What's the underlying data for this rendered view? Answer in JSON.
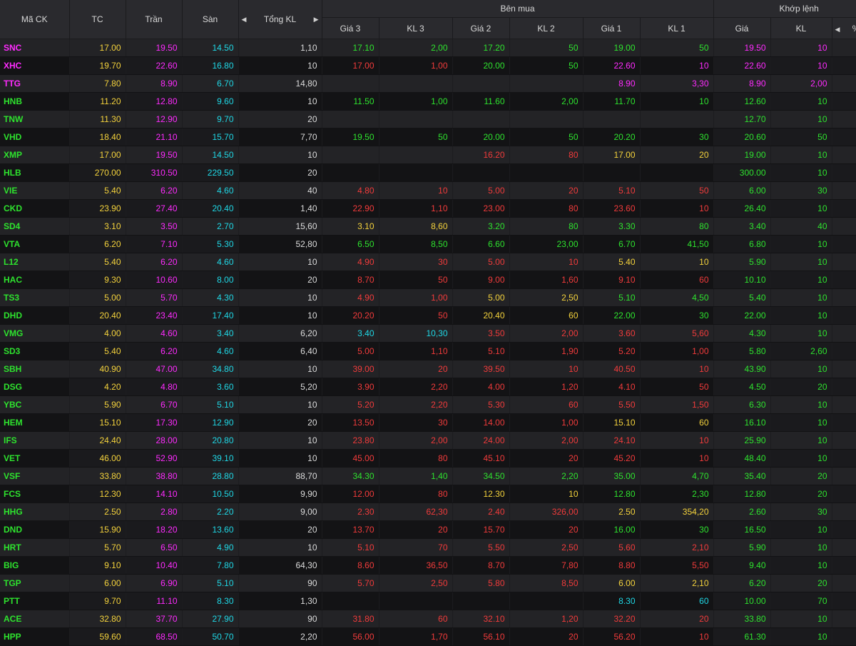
{
  "header": {
    "ma_ck": "Mã CK",
    "tc": "TC",
    "tran": "Trần",
    "san": "Sàn",
    "tong_kl": "Tổng KL",
    "ben_mua": "Bên mua",
    "khop_lenh": "Khớp lệnh",
    "gia3": "Giá 3",
    "kl3": "KL 3",
    "gia2": "Giá 2",
    "kl2": "KL 2",
    "gia1": "Giá 1",
    "kl1": "KL 1",
    "khop_gia": "Giá",
    "khop_kl": "KL",
    "pct": "%"
  },
  "colors": {
    "purple": "#ff2bff",
    "yellow": "#f5d33c",
    "cyan": "#1fd8e6",
    "green": "#2ee32e",
    "red": "#f23b3b"
  },
  "rows": [
    {
      "sym": "SNC",
      "symc": "purple",
      "tc": "17.00",
      "tran": "19.50",
      "san": "14.50",
      "vol": "1,10",
      "g3": "17.10",
      "g3c": "green",
      "k3": "2,00",
      "g2": "17.20",
      "g2c": "green",
      "k2": "50",
      "g1": "19.00",
      "g1c": "green",
      "k1": "50",
      "kg": "19.50",
      "kgc": "purple",
      "kk": "10"
    },
    {
      "sym": "XHC",
      "symc": "purple",
      "tc": "19.70",
      "tran": "22.60",
      "san": "16.80",
      "vol": "10",
      "g3": "17.00",
      "g3c": "red",
      "k3": "1,00",
      "g2": "20.00",
      "g2c": "green",
      "k2": "50",
      "g1": "22.60",
      "g1c": "purple",
      "k1": "10",
      "kg": "22.60",
      "kgc": "purple",
      "kk": "10"
    },
    {
      "sym": "TTG",
      "symc": "purple",
      "tc": "7.80",
      "tran": "8.90",
      "san": "6.70",
      "vol": "14,80",
      "g3": "",
      "g3c": "green",
      "k3": "",
      "g2": "",
      "g2c": "green",
      "k2": "",
      "g1": "8.90",
      "g1c": "purple",
      "k1": "3,30",
      "kg": "8.90",
      "kgc": "purple",
      "kk": "2,00"
    },
    {
      "sym": "HNB",
      "symc": "green",
      "tc": "11.20",
      "tran": "12.80",
      "san": "9.60",
      "vol": "10",
      "g3": "11.50",
      "g3c": "green",
      "k3": "1,00",
      "g2": "11.60",
      "g2c": "green",
      "k2": "2,00",
      "g1": "11.70",
      "g1c": "green",
      "k1": "10",
      "kg": "12.60",
      "kgc": "green",
      "kk": "10"
    },
    {
      "sym": "TNW",
      "symc": "green",
      "tc": "11.30",
      "tran": "12.90",
      "san": "9.70",
      "vol": "20",
      "g3": "",
      "g3c": "green",
      "k3": "",
      "g2": "",
      "g2c": "green",
      "k2": "",
      "g1": "",
      "g1c": "green",
      "k1": "",
      "kg": "12.70",
      "kgc": "green",
      "kk": "10"
    },
    {
      "sym": "VHD",
      "symc": "green",
      "tc": "18.40",
      "tran": "21.10",
      "san": "15.70",
      "vol": "7,70",
      "g3": "19.50",
      "g3c": "green",
      "k3": "50",
      "g2": "20.00",
      "g2c": "green",
      "k2": "50",
      "g1": "20.20",
      "g1c": "green",
      "k1": "30",
      "kg": "20.60",
      "kgc": "green",
      "kk": "50"
    },
    {
      "sym": "XMP",
      "symc": "green",
      "tc": "17.00",
      "tran": "19.50",
      "san": "14.50",
      "vol": "10",
      "g3": "",
      "g3c": "green",
      "k3": "",
      "g2": "16.20",
      "g2c": "red",
      "k2": "80",
      "g1": "17.00",
      "g1c": "yellow",
      "k1": "20",
      "kg": "19.00",
      "kgc": "green",
      "kk": "10"
    },
    {
      "sym": "HLB",
      "symc": "green",
      "tc": "270.00",
      "tran": "310.50",
      "san": "229.50",
      "vol": "20",
      "g3": "",
      "g3c": "green",
      "k3": "",
      "g2": "",
      "g2c": "green",
      "k2": "",
      "g1": "",
      "g1c": "green",
      "k1": "",
      "kg": "300.00",
      "kgc": "green",
      "kk": "10"
    },
    {
      "sym": "VIE",
      "symc": "green",
      "tc": "5.40",
      "tran": "6.20",
      "san": "4.60",
      "vol": "40",
      "g3": "4.80",
      "g3c": "red",
      "k3": "10",
      "g2": "5.00",
      "g2c": "red",
      "k2": "20",
      "g1": "5.10",
      "g1c": "red",
      "k1": "50",
      "kg": "6.00",
      "kgc": "green",
      "kk": "30"
    },
    {
      "sym": "CKD",
      "symc": "green",
      "tc": "23.90",
      "tran": "27.40",
      "san": "20.40",
      "vol": "1,40",
      "g3": "22.90",
      "g3c": "red",
      "k3": "1,10",
      "g2": "23.00",
      "g2c": "red",
      "k2": "80",
      "g1": "23.60",
      "g1c": "red",
      "k1": "10",
      "kg": "26.40",
      "kgc": "green",
      "kk": "10"
    },
    {
      "sym": "SD4",
      "symc": "green",
      "tc": "3.10",
      "tran": "3.50",
      "san": "2.70",
      "vol": "15,60",
      "g3": "3.10",
      "g3c": "yellow",
      "k3": "8,60",
      "g2": "3.20",
      "g2c": "green",
      "k2": "80",
      "g1": "3.30",
      "g1c": "green",
      "k1": "80",
      "kg": "3.40",
      "kgc": "green",
      "kk": "40"
    },
    {
      "sym": "VTA",
      "symc": "green",
      "tc": "6.20",
      "tran": "7.10",
      "san": "5.30",
      "vol": "52,80",
      "g3": "6.50",
      "g3c": "green",
      "k3": "8,50",
      "g2": "6.60",
      "g2c": "green",
      "k2": "23,00",
      "g1": "6.70",
      "g1c": "green",
      "k1": "41,50",
      "kg": "6.80",
      "kgc": "green",
      "kk": "10"
    },
    {
      "sym": "L12",
      "symc": "green",
      "tc": "5.40",
      "tran": "6.20",
      "san": "4.60",
      "vol": "10",
      "g3": "4.90",
      "g3c": "red",
      "k3": "30",
      "g2": "5.00",
      "g2c": "red",
      "k2": "10",
      "g1": "5.40",
      "g1c": "yellow",
      "k1": "10",
      "kg": "5.90",
      "kgc": "green",
      "kk": "10"
    },
    {
      "sym": "HAC",
      "symc": "green",
      "tc": "9.30",
      "tran": "10.60",
      "san": "8.00",
      "vol": "20",
      "g3": "8.70",
      "g3c": "red",
      "k3": "50",
      "g2": "9.00",
      "g2c": "red",
      "k2": "1,60",
      "g1": "9.10",
      "g1c": "red",
      "k1": "60",
      "kg": "10.10",
      "kgc": "green",
      "kk": "10"
    },
    {
      "sym": "TS3",
      "symc": "green",
      "tc": "5.00",
      "tran": "5.70",
      "san": "4.30",
      "vol": "10",
      "g3": "4.90",
      "g3c": "red",
      "k3": "1,00",
      "g2": "5.00",
      "g2c": "yellow",
      "k2": "2,50",
      "g1": "5.10",
      "g1c": "green",
      "k1": "4,50",
      "kg": "5.40",
      "kgc": "green",
      "kk": "10"
    },
    {
      "sym": "DHD",
      "symc": "green",
      "tc": "20.40",
      "tran": "23.40",
      "san": "17.40",
      "vol": "10",
      "g3": "20.20",
      "g3c": "red",
      "k3": "50",
      "g2": "20.40",
      "g2c": "yellow",
      "k2": "60",
      "g1": "22.00",
      "g1c": "green",
      "k1": "30",
      "kg": "22.00",
      "kgc": "green",
      "kk": "10"
    },
    {
      "sym": "VMG",
      "symc": "green",
      "tc": "4.00",
      "tran": "4.60",
      "san": "3.40",
      "vol": "6,20",
      "g3": "3.40",
      "g3c": "cyan",
      "k3": "10,30",
      "g2": "3.50",
      "g2c": "red",
      "k2": "2,00",
      "g1": "3.60",
      "g1c": "red",
      "k1": "5,60",
      "kg": "4.30",
      "kgc": "green",
      "kk": "10"
    },
    {
      "sym": "SD3",
      "symc": "green",
      "tc": "5.40",
      "tran": "6.20",
      "san": "4.60",
      "vol": "6,40",
      "g3": "5.00",
      "g3c": "red",
      "k3": "1,10",
      "g2": "5.10",
      "g2c": "red",
      "k2": "1,90",
      "g1": "5.20",
      "g1c": "red",
      "k1": "1,00",
      "kg": "5.80",
      "kgc": "green",
      "kk": "2,60"
    },
    {
      "sym": "SBH",
      "symc": "green",
      "tc": "40.90",
      "tran": "47.00",
      "san": "34.80",
      "vol": "10",
      "g3": "39.00",
      "g3c": "red",
      "k3": "20",
      "g2": "39.50",
      "g2c": "red",
      "k2": "10",
      "g1": "40.50",
      "g1c": "red",
      "k1": "10",
      "kg": "43.90",
      "kgc": "green",
      "kk": "10"
    },
    {
      "sym": "DSG",
      "symc": "green",
      "tc": "4.20",
      "tran": "4.80",
      "san": "3.60",
      "vol": "5,20",
      "g3": "3.90",
      "g3c": "red",
      "k3": "2,20",
      "g2": "4.00",
      "g2c": "red",
      "k2": "1,20",
      "g1": "4.10",
      "g1c": "red",
      "k1": "50",
      "kg": "4.50",
      "kgc": "green",
      "kk": "20"
    },
    {
      "sym": "YBC",
      "symc": "green",
      "tc": "5.90",
      "tran": "6.70",
      "san": "5.10",
      "vol": "10",
      "g3": "5.20",
      "g3c": "red",
      "k3": "2,20",
      "g2": "5.30",
      "g2c": "red",
      "k2": "60",
      "g1": "5.50",
      "g1c": "red",
      "k1": "1,50",
      "kg": "6.30",
      "kgc": "green",
      "kk": "10"
    },
    {
      "sym": "HEM",
      "symc": "green",
      "tc": "15.10",
      "tran": "17.30",
      "san": "12.90",
      "vol": "20",
      "g3": "13.50",
      "g3c": "red",
      "k3": "30",
      "g2": "14.00",
      "g2c": "red",
      "k2": "1,00",
      "g1": "15.10",
      "g1c": "yellow",
      "k1": "60",
      "kg": "16.10",
      "kgc": "green",
      "kk": "10"
    },
    {
      "sym": "IFS",
      "symc": "green",
      "tc": "24.40",
      "tran": "28.00",
      "san": "20.80",
      "vol": "10",
      "g3": "23.80",
      "g3c": "red",
      "k3": "2,00",
      "g2": "24.00",
      "g2c": "red",
      "k2": "2,00",
      "g1": "24.10",
      "g1c": "red",
      "k1": "10",
      "kg": "25.90",
      "kgc": "green",
      "kk": "10"
    },
    {
      "sym": "VET",
      "symc": "green",
      "tc": "46.00",
      "tran": "52.90",
      "san": "39.10",
      "vol": "10",
      "g3": "45.00",
      "g3c": "red",
      "k3": "80",
      "g2": "45.10",
      "g2c": "red",
      "k2": "20",
      "g1": "45.20",
      "g1c": "red",
      "k1": "10",
      "kg": "48.40",
      "kgc": "green",
      "kk": "10"
    },
    {
      "sym": "VSF",
      "symc": "green",
      "tc": "33.80",
      "tran": "38.80",
      "san": "28.80",
      "vol": "88,70",
      "g3": "34.30",
      "g3c": "green",
      "k3": "1,40",
      "g2": "34.50",
      "g2c": "green",
      "k2": "2,20",
      "g1": "35.00",
      "g1c": "green",
      "k1": "4,70",
      "kg": "35.40",
      "kgc": "green",
      "kk": "20"
    },
    {
      "sym": "FCS",
      "symc": "green",
      "tc": "12.30",
      "tran": "14.10",
      "san": "10.50",
      "vol": "9,90",
      "g3": "12.00",
      "g3c": "red",
      "k3": "80",
      "g2": "12.30",
      "g2c": "yellow",
      "k2": "10",
      "g1": "12.80",
      "g1c": "green",
      "k1": "2,30",
      "kg": "12.80",
      "kgc": "green",
      "kk": "20"
    },
    {
      "sym": "HHG",
      "symc": "green",
      "tc": "2.50",
      "tran": "2.80",
      "san": "2.20",
      "vol": "9,00",
      "g3": "2.30",
      "g3c": "red",
      "k3": "62,30",
      "g2": "2.40",
      "g2c": "red",
      "k2": "326,00",
      "g1": "2.50",
      "g1c": "yellow",
      "k1": "354,20",
      "kg": "2.60",
      "kgc": "green",
      "kk": "30"
    },
    {
      "sym": "DND",
      "symc": "green",
      "tc": "15.90",
      "tran": "18.20",
      "san": "13.60",
      "vol": "20",
      "g3": "13.70",
      "g3c": "red",
      "k3": "20",
      "g2": "15.70",
      "g2c": "red",
      "k2": "20",
      "g1": "16.00",
      "g1c": "green",
      "k1": "30",
      "kg": "16.50",
      "kgc": "green",
      "kk": "10"
    },
    {
      "sym": "HRT",
      "symc": "green",
      "tc": "5.70",
      "tran": "6.50",
      "san": "4.90",
      "vol": "10",
      "g3": "5.10",
      "g3c": "red",
      "k3": "70",
      "g2": "5.50",
      "g2c": "red",
      "k2": "2,50",
      "g1": "5.60",
      "g1c": "red",
      "k1": "2,10",
      "kg": "5.90",
      "kgc": "green",
      "kk": "10"
    },
    {
      "sym": "BIG",
      "symc": "green",
      "tc": "9.10",
      "tran": "10.40",
      "san": "7.80",
      "vol": "64,30",
      "g3": "8.60",
      "g3c": "red",
      "k3": "36,50",
      "g2": "8.70",
      "g2c": "red",
      "k2": "7,80",
      "g1": "8.80",
      "g1c": "red",
      "k1": "5,50",
      "kg": "9.40",
      "kgc": "green",
      "kk": "10"
    },
    {
      "sym": "TGP",
      "symc": "green",
      "tc": "6.00",
      "tran": "6.90",
      "san": "5.10",
      "vol": "90",
      "g3": "5.70",
      "g3c": "red",
      "k3": "2,50",
      "g2": "5.80",
      "g2c": "red",
      "k2": "8,50",
      "g1": "6.00",
      "g1c": "yellow",
      "k1": "2,10",
      "kg": "6.20",
      "kgc": "green",
      "kk": "20"
    },
    {
      "sym": "PTT",
      "symc": "green",
      "tc": "9.70",
      "tran": "11.10",
      "san": "8.30",
      "vol": "1,30",
      "g3": "",
      "g3c": "green",
      "k3": "",
      "g2": "",
      "g2c": "green",
      "k2": "",
      "g1": "8.30",
      "g1c": "cyan",
      "k1": "60",
      "kg": "10.00",
      "kgc": "green",
      "kk": "70"
    },
    {
      "sym": "ACE",
      "symc": "green",
      "tc": "32.80",
      "tran": "37.70",
      "san": "27.90",
      "vol": "90",
      "g3": "31.80",
      "g3c": "red",
      "k3": "60",
      "g2": "32.10",
      "g2c": "red",
      "k2": "1,20",
      "g1": "32.20",
      "g1c": "red",
      "k1": "20",
      "kg": "33.80",
      "kgc": "green",
      "kk": "10"
    },
    {
      "sym": "HPP",
      "symc": "green",
      "tc": "59.60",
      "tran": "68.50",
      "san": "50.70",
      "vol": "2,20",
      "g3": "56.00",
      "g3c": "red",
      "k3": "1,70",
      "g2": "56.10",
      "g2c": "red",
      "k2": "20",
      "g1": "56.20",
      "g1c": "red",
      "k1": "10",
      "kg": "61.30",
      "kgc": "green",
      "kk": "10"
    }
  ]
}
